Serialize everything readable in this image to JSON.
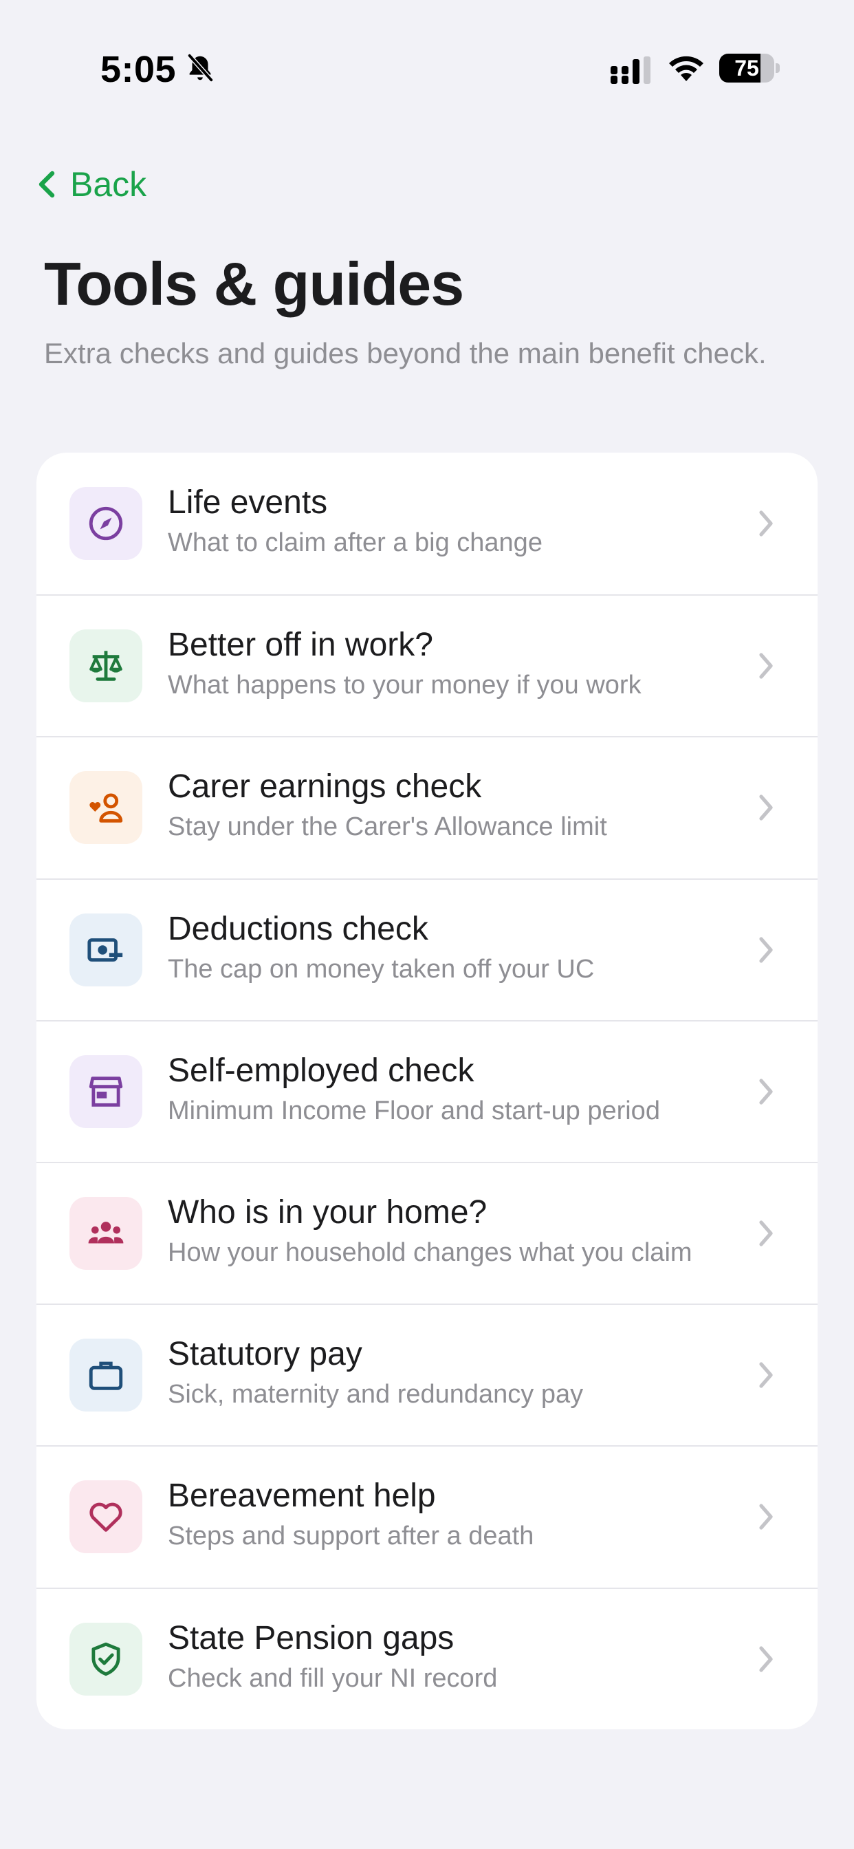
{
  "status_bar": {
    "time": "5:05",
    "battery_percent": 75
  },
  "nav": {
    "back_label": "Back"
  },
  "header": {
    "title": "Tools & guides",
    "subtitle": "Extra checks and guides beyond the main benefit check."
  },
  "colors": {
    "accent_green": "#1aa34a",
    "background": "#f2f2f7",
    "card": "#ffffff"
  },
  "tools": [
    {
      "title": "Life events",
      "subtitle": "What to claim after a big change",
      "icon": "compass-icon",
      "icon_color": "#7b3fa0",
      "tile_color": "#f1ebfa"
    },
    {
      "title": "Better off in work?",
      "subtitle": "What happens to your money if you work",
      "icon": "scales-icon",
      "icon_color": "#1e7a3c",
      "tile_color": "#e8f5ec"
    },
    {
      "title": "Carer earnings check",
      "subtitle": "Stay under the Carer's Allowance limit",
      "icon": "carer-icon",
      "icon_color": "#d35400",
      "tile_color": "#fdf1e6"
    },
    {
      "title": "Deductions check",
      "subtitle": "The cap on money taken off your UC",
      "icon": "money-minus-icon",
      "icon_color": "#1f4f7a",
      "tile_color": "#e8f0f8"
    },
    {
      "title": "Self-employed check",
      "subtitle": "Minimum Income Floor and start-up period",
      "icon": "storefront-icon",
      "icon_color": "#7b3fa0",
      "tile_color": "#f1ebfa"
    },
    {
      "title": "Who is in your home?",
      "subtitle": "How your household changes what you claim",
      "icon": "household-icon",
      "icon_color": "#b0305c",
      "tile_color": "#fbe8ee"
    },
    {
      "title": "Statutory pay",
      "subtitle": "Sick, maternity and redundancy pay",
      "icon": "briefcase-icon",
      "icon_color": "#1f4f7a",
      "tile_color": "#e8f0f8"
    },
    {
      "title": "Bereavement help",
      "subtitle": "Steps and support after a death",
      "icon": "heart-icon",
      "icon_color": "#b0305c",
      "tile_color": "#fbe8ee"
    },
    {
      "title": "State Pension gaps",
      "subtitle": "Check and fill your NI record",
      "icon": "shield-check-icon",
      "icon_color": "#1e7a3c",
      "tile_color": "#e8f5ec"
    }
  ]
}
